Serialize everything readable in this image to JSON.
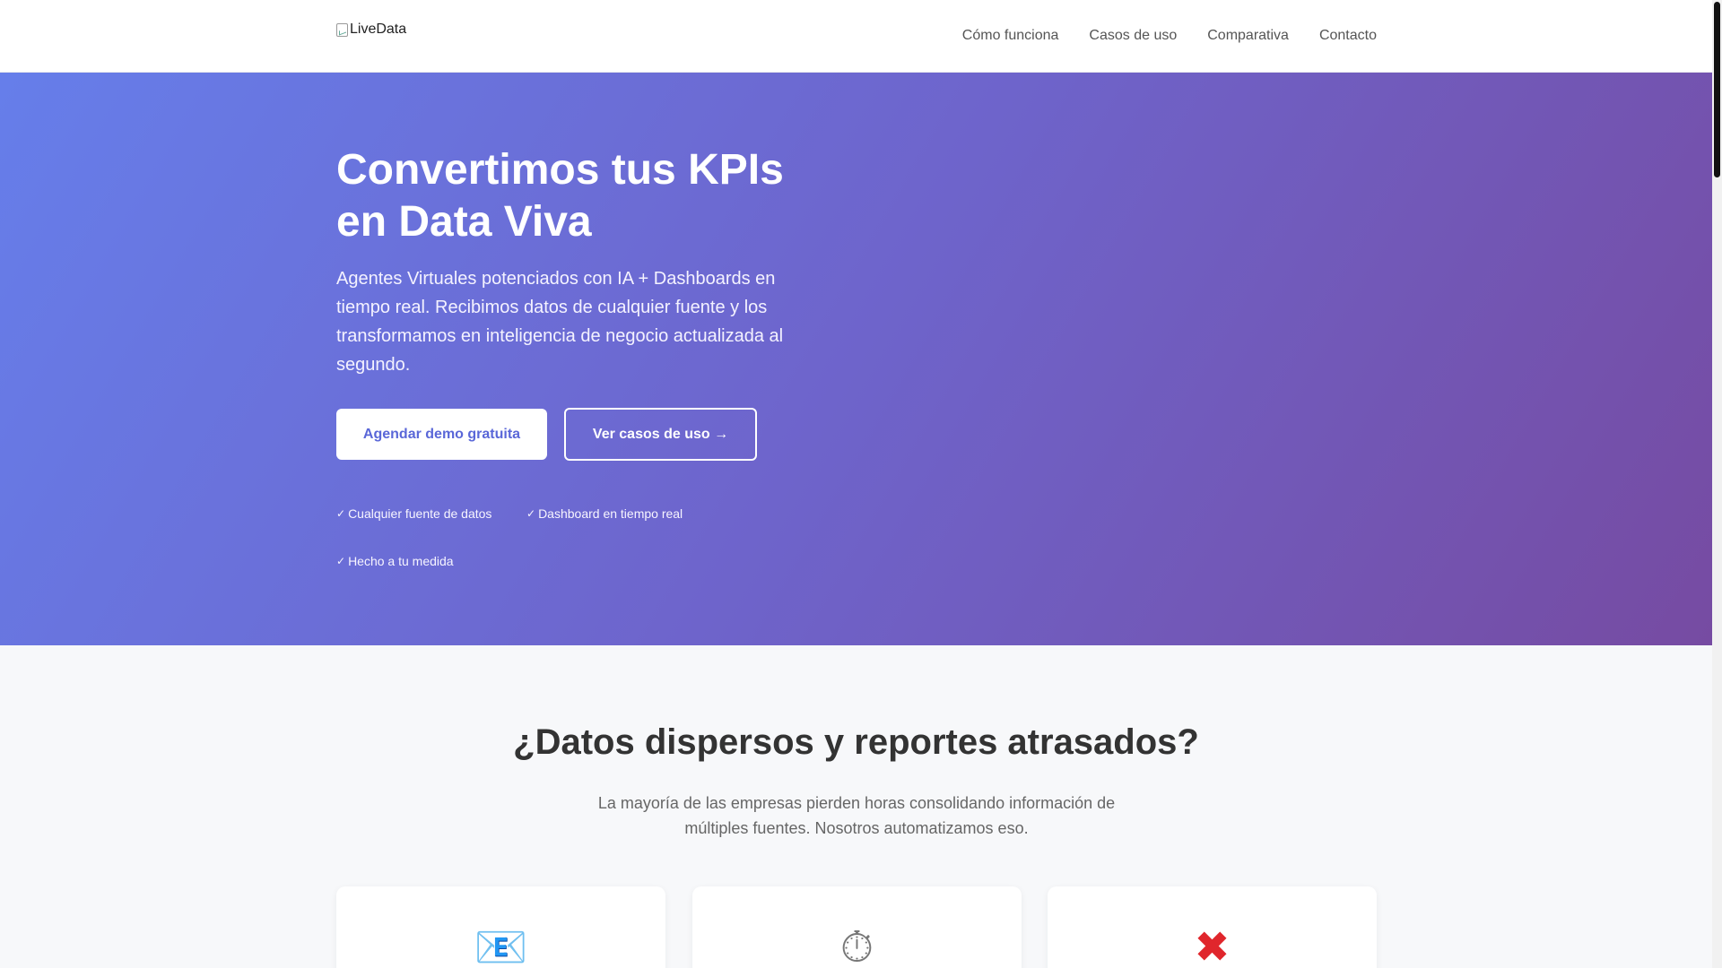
{
  "header": {
    "logo_alt": "LiveData",
    "nav": [
      {
        "label": "Cómo funciona"
      },
      {
        "label": "Casos de uso"
      },
      {
        "label": "Comparativa"
      },
      {
        "label": "Contacto"
      }
    ]
  },
  "hero": {
    "title": "Convertimos tus KPIs en Data Viva",
    "subtitle": "Agentes Virtuales potenciados con IA + Dashboards en tiempo real. Recibimos datos de cualquier fuente y los transformamos en inteligencia de negocio actualizada al segundo.",
    "primary_cta": "Agendar demo gratuita",
    "secondary_cta": "Ver casos de uso →",
    "features": [
      {
        "icon": "check-icon",
        "label": "Cualquier fuente de datos"
      },
      {
        "icon": "check-icon",
        "label": "Dashboard en tiempo real"
      },
      {
        "icon": "check-icon",
        "label": "Hecho a tu medida"
      }
    ],
    "gradient_colors": [
      "#667eea",
      "#764ba2"
    ]
  },
  "problem": {
    "title": "¿Datos dispersos y reportes atrasados?",
    "subtitle": "La mayoría de las empresas pierden horas consolidando información de múltiples fuentes. Nosotros automatizamos eso.",
    "cards": [
      {
        "icon": "envelope-icon",
        "glyph": "📧"
      },
      {
        "icon": "stopwatch-icon",
        "glyph": "⏱"
      },
      {
        "icon": "cross-icon",
        "glyph": "✖"
      }
    ]
  }
}
